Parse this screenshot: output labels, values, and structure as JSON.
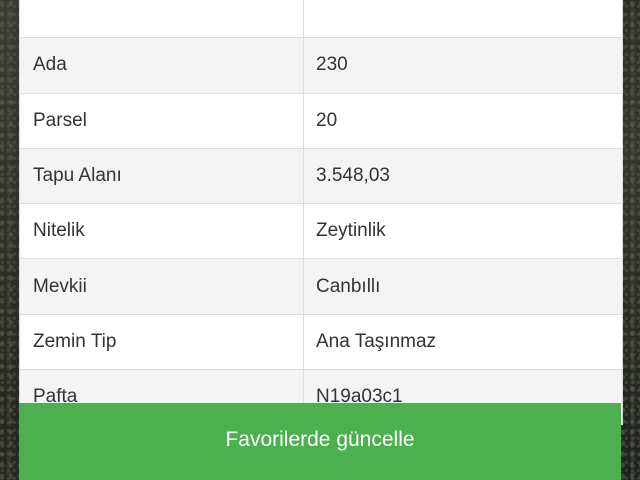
{
  "rows": [
    {
      "label": "",
      "value": "",
      "partial": true
    },
    {
      "label": "Ada",
      "value": "230"
    },
    {
      "label": "Parsel",
      "value": "20"
    },
    {
      "label": "Tapu Alanı",
      "value": "3.548,03"
    },
    {
      "label": "Nitelik",
      "value": "Zeytinlik"
    },
    {
      "label": "Mevkii",
      "value": "Canbıllı"
    },
    {
      "label": "Zemin Tip",
      "value": "Ana Taşınmaz"
    },
    {
      "label": "Pafta",
      "value": "N19a03c1"
    }
  ],
  "button": {
    "label": "Favorilerde güncelle",
    "color": "#4caf50"
  },
  "colors": {
    "row_alt": "#f4f4f4",
    "row": "#ffffff",
    "text": "#333333",
    "border": "#dcdcdc"
  }
}
